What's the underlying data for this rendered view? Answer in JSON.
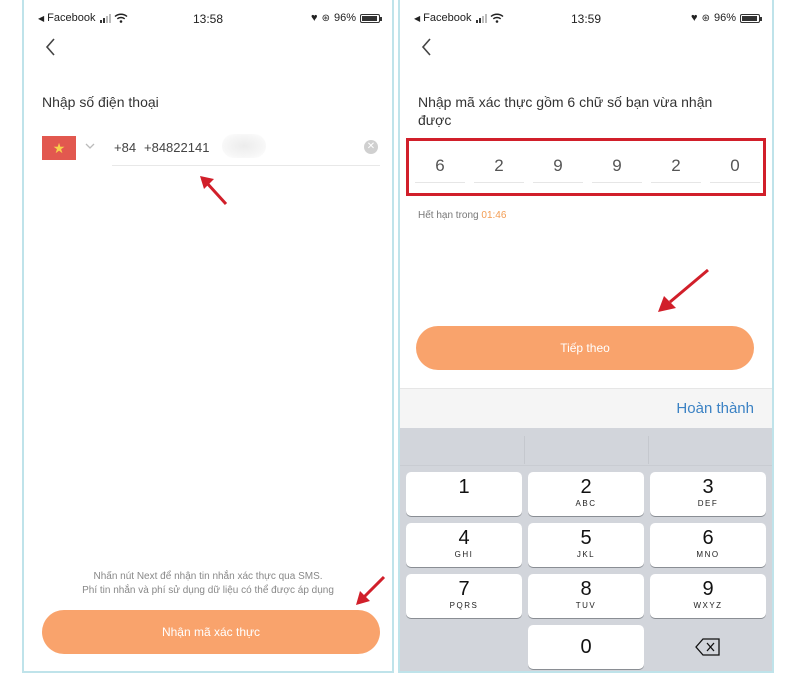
{
  "left_screen": {
    "status_bar": {
      "carrier": "Facebook",
      "time": "13:58",
      "battery": "96%"
    },
    "title": "Nhập số điện thoại",
    "phone_input": {
      "dial_code": "+84",
      "value": "+84822141"
    },
    "notice_line1": "Nhấn nút Next để nhận tin nhắn xác thực qua SMS.",
    "notice_line2": "Phí tin nhắn và phí sử dụng dữ liệu có thể được áp dụng",
    "primary_button": "Nhận mã xác thực"
  },
  "right_screen": {
    "status_bar": {
      "carrier": "Facebook",
      "time": "13:59",
      "battery": "96%"
    },
    "title": "Nhập mã xác thực gồm 6 chữ số bạn vừa nhận được",
    "code_digits": [
      "6",
      "2",
      "9",
      "9",
      "2",
      "0"
    ],
    "expire_label": "Hết hạn trong",
    "expire_time": "01:46",
    "primary_button": "Tiếp theo",
    "done_button": "Hoàn thành",
    "keypad": [
      {
        "num": "1",
        "letters": ""
      },
      {
        "num": "2",
        "letters": "ABC"
      },
      {
        "num": "3",
        "letters": "DEF"
      },
      {
        "num": "4",
        "letters": "GHI"
      },
      {
        "num": "5",
        "letters": "JKL"
      },
      {
        "num": "6",
        "letters": "MNO"
      },
      {
        "num": "7",
        "letters": "PQRS"
      },
      {
        "num": "8",
        "letters": "TUV"
      },
      {
        "num": "9",
        "letters": "WXYZ"
      },
      {
        "num": "0",
        "letters": ""
      }
    ]
  },
  "colors": {
    "accent_orange": "#f9a36c",
    "highlight_red": "#d11f2a",
    "link_blue": "#3b82c4",
    "flag_red": "#e2584f",
    "flag_star": "#f8d24b",
    "timer_orange": "#f39c52"
  },
  "icons": [
    "back-chevron-icon",
    "vietnam-flag-icon",
    "chevron-down-icon",
    "clear-icon",
    "wifi-icon",
    "heart-icon",
    "lock-rotation-icon",
    "battery-icon",
    "backspace-icon",
    "red-arrow-annotation"
  ]
}
